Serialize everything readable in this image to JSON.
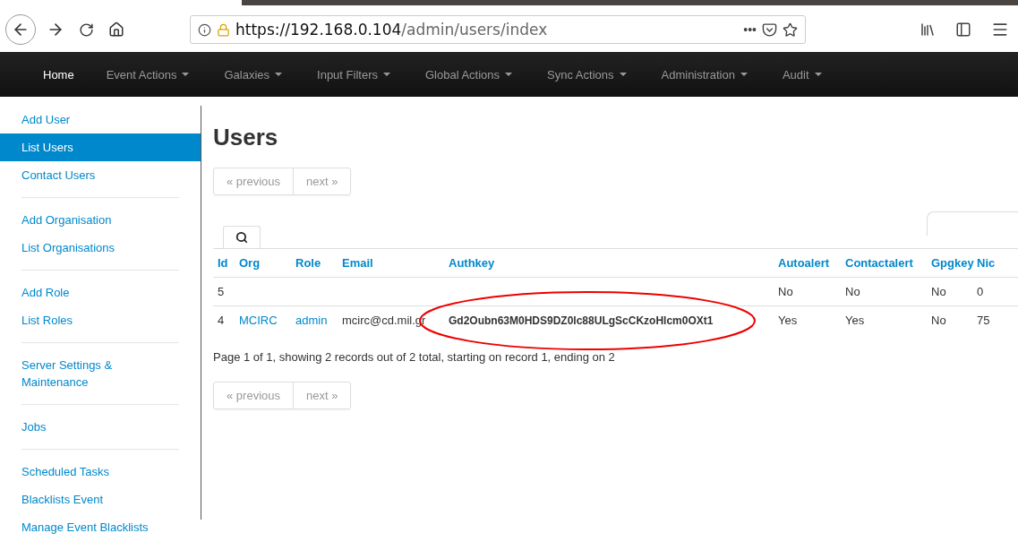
{
  "browser": {
    "url_host": "https://192.168.0.104",
    "url_path": "/admin/users/index",
    "page_actions": "•••"
  },
  "nav": [
    {
      "label": "Home",
      "dropdown": false
    },
    {
      "label": "Event Actions",
      "dropdown": true
    },
    {
      "label": "Galaxies",
      "dropdown": true
    },
    {
      "label": "Input Filters",
      "dropdown": true
    },
    {
      "label": "Global Actions",
      "dropdown": true
    },
    {
      "label": "Sync Actions",
      "dropdown": true
    },
    {
      "label": "Administration",
      "dropdown": true
    },
    {
      "label": "Audit",
      "dropdown": true
    }
  ],
  "sidebar": {
    "groups": [
      [
        {
          "label": "Add User",
          "selected": false
        },
        {
          "label": "List Users",
          "selected": true
        },
        {
          "label": "Contact Users",
          "selected": false
        }
      ],
      [
        {
          "label": "Add Organisation",
          "selected": false
        },
        {
          "label": "List Organisations",
          "selected": false
        }
      ],
      [
        {
          "label": "Add Role",
          "selected": false
        },
        {
          "label": "List Roles",
          "selected": false
        }
      ],
      [
        {
          "label": "Server Settings & Maintenance",
          "selected": false
        }
      ],
      [
        {
          "label": "Jobs",
          "selected": false
        }
      ],
      [
        {
          "label": "Scheduled Tasks",
          "selected": false
        },
        {
          "label": "Blacklists Event",
          "selected": false
        },
        {
          "label": "Manage Event Blacklists",
          "selected": false
        }
      ]
    ]
  },
  "title": "Users",
  "pager_top": {
    "previous": "« previous",
    "next": "next »"
  },
  "table": {
    "columns": [
      "Id",
      "Org",
      "Role",
      "Email",
      "Authkey",
      "Autoalert",
      "Contactalert",
      "Gpgkey",
      "Nic"
    ],
    "rows": [
      {
        "cells": [
          "5",
          "",
          "",
          "",
          "",
          "No",
          "No",
          "No",
          "0"
        ]
      },
      {
        "cells": [
          "4",
          "MCIRC",
          "admin",
          "mcirc@cd.mil.gr",
          "Gd2Oubn63M0HDS9DZ0lc88ULgScCKzoHlcm0OXt1",
          "Yes",
          "Yes",
          "No",
          "75"
        ]
      }
    ]
  },
  "summary": "Page 1 of 1, showing 2 records out of 2 total, starting on record 1, ending on 2",
  "pager_bottom": {
    "previous": "« previous",
    "next": "next »"
  }
}
